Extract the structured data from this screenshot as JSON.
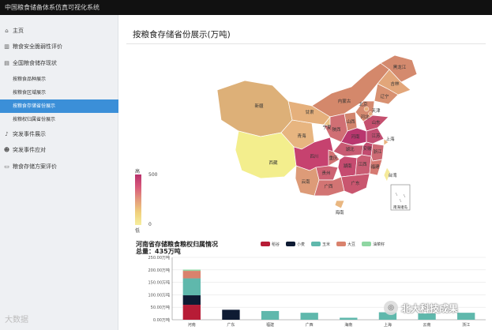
{
  "app_title": "中国粮食储备体系仿真可视化系统",
  "sidebar": {
    "items": [
      {
        "icon": "home-icon",
        "glyph": "⌂",
        "label": "主页"
      },
      {
        "icon": "bar-chart-icon",
        "glyph": "▥",
        "label": "粮食安全脆弱性评价"
      },
      {
        "icon": "list-icon",
        "glyph": "▤",
        "label": "全国粮食储存现状"
      },
      {
        "icon": "bell-icon",
        "glyph": "♪",
        "label": "突发事件展示"
      },
      {
        "icon": "people-icon",
        "glyph": "☻",
        "label": "突发事件应对"
      },
      {
        "icon": "document-icon",
        "glyph": "▭",
        "label": "粮食存储方案评价"
      }
    ],
    "sub_items": [
      {
        "label": "按粮食品种展示"
      },
      {
        "label": "按粮食区域展示"
      },
      {
        "label": "按粮食存储省份展示"
      },
      {
        "label": "按粮权归属省份展示"
      }
    ]
  },
  "main": {
    "title": "按粮食存储省份展示(万吨)"
  },
  "visual_map": {
    "top_label": "高",
    "max": "500",
    "min": "0",
    "bottom_label": "低"
  },
  "map": {
    "provinces": [
      "新疆",
      "西藏",
      "青海",
      "甘肃",
      "宁夏",
      "内蒙古",
      "黑龙江",
      "吉林",
      "辽宁",
      "北京",
      "天津",
      "河北",
      "山西",
      "山东",
      "河南",
      "陕西",
      "四川",
      "重庆",
      "湖北",
      "安徽",
      "江苏",
      "上海",
      "浙江",
      "湖南",
      "江西",
      "福建",
      "贵州",
      "云南",
      "广西",
      "广东",
      "海南",
      "台湾"
    ],
    "inset_label": "南海诸岛"
  },
  "chart": {
    "title": "河南省存储粮食粮权归属情况",
    "subtitle": "总量：435万吨",
    "legend": [
      {
        "name": "稻谷",
        "color": "#b71c36"
      },
      {
        "name": "小麦",
        "color": "#0e1b33"
      },
      {
        "name": "玉米",
        "color": "#5fb8ac"
      },
      {
        "name": "大豆",
        "color": "#d9826d"
      },
      {
        "name": "油菜籽",
        "color": "#8fd6a2"
      }
    ]
  },
  "chart_data": {
    "type": "bar",
    "stacked": true,
    "categories": [
      "河南",
      "广东",
      "福建",
      "广西",
      "海南",
      "上海",
      "云南",
      "浙江"
    ],
    "y_tick_labels": [
      "0.00万吨",
      "50.00万吨",
      "100.00万吨",
      "150.00万吨",
      "200.00万吨",
      "250.00万吨"
    ],
    "ylim": [
      0,
      250
    ],
    "series": [
      {
        "name": "稻谷",
        "values": [
          60,
          0,
          0,
          0,
          0,
          0,
          0,
          0
        ]
      },
      {
        "name": "小麦",
        "values": [
          38,
          40,
          0,
          0,
          0,
          0,
          0,
          0
        ]
      },
      {
        "name": "玉米",
        "values": [
          68,
          0,
          35,
          28,
          8,
          30,
          25,
          28
        ]
      },
      {
        "name": "大豆",
        "values": [
          30,
          0,
          0,
          0,
          0,
          0,
          0,
          0
        ]
      },
      {
        "name": "油菜籽",
        "values": [
          5,
          0,
          0,
          0,
          0,
          0,
          0,
          0
        ]
      }
    ]
  },
  "watermarks": {
    "left": "大数据",
    "right": "北大科技成果"
  }
}
